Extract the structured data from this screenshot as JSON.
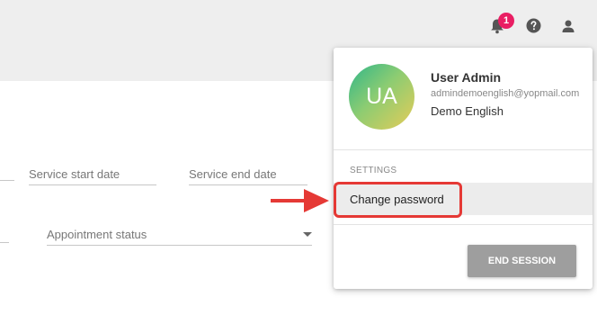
{
  "header": {
    "notification_count": "1",
    "icons": [
      "bell-icon",
      "help-icon",
      "user-icon"
    ]
  },
  "form": {
    "service_start_label": "Service start date",
    "service_end_label": "Service end date",
    "appointment_status_label": "Appointment status"
  },
  "user_menu": {
    "avatar_initials": "UA",
    "user_name": "User Admin",
    "user_email": "admindemoenglish@yopmail.com",
    "organization": "Demo English",
    "settings_label": "SETTINGS",
    "change_password_label": "Change password",
    "end_session_label": "END SESSION"
  },
  "colors": {
    "badge": "#e91e63",
    "annotation": "#e53935",
    "end_session_button": "#9e9e9e"
  }
}
